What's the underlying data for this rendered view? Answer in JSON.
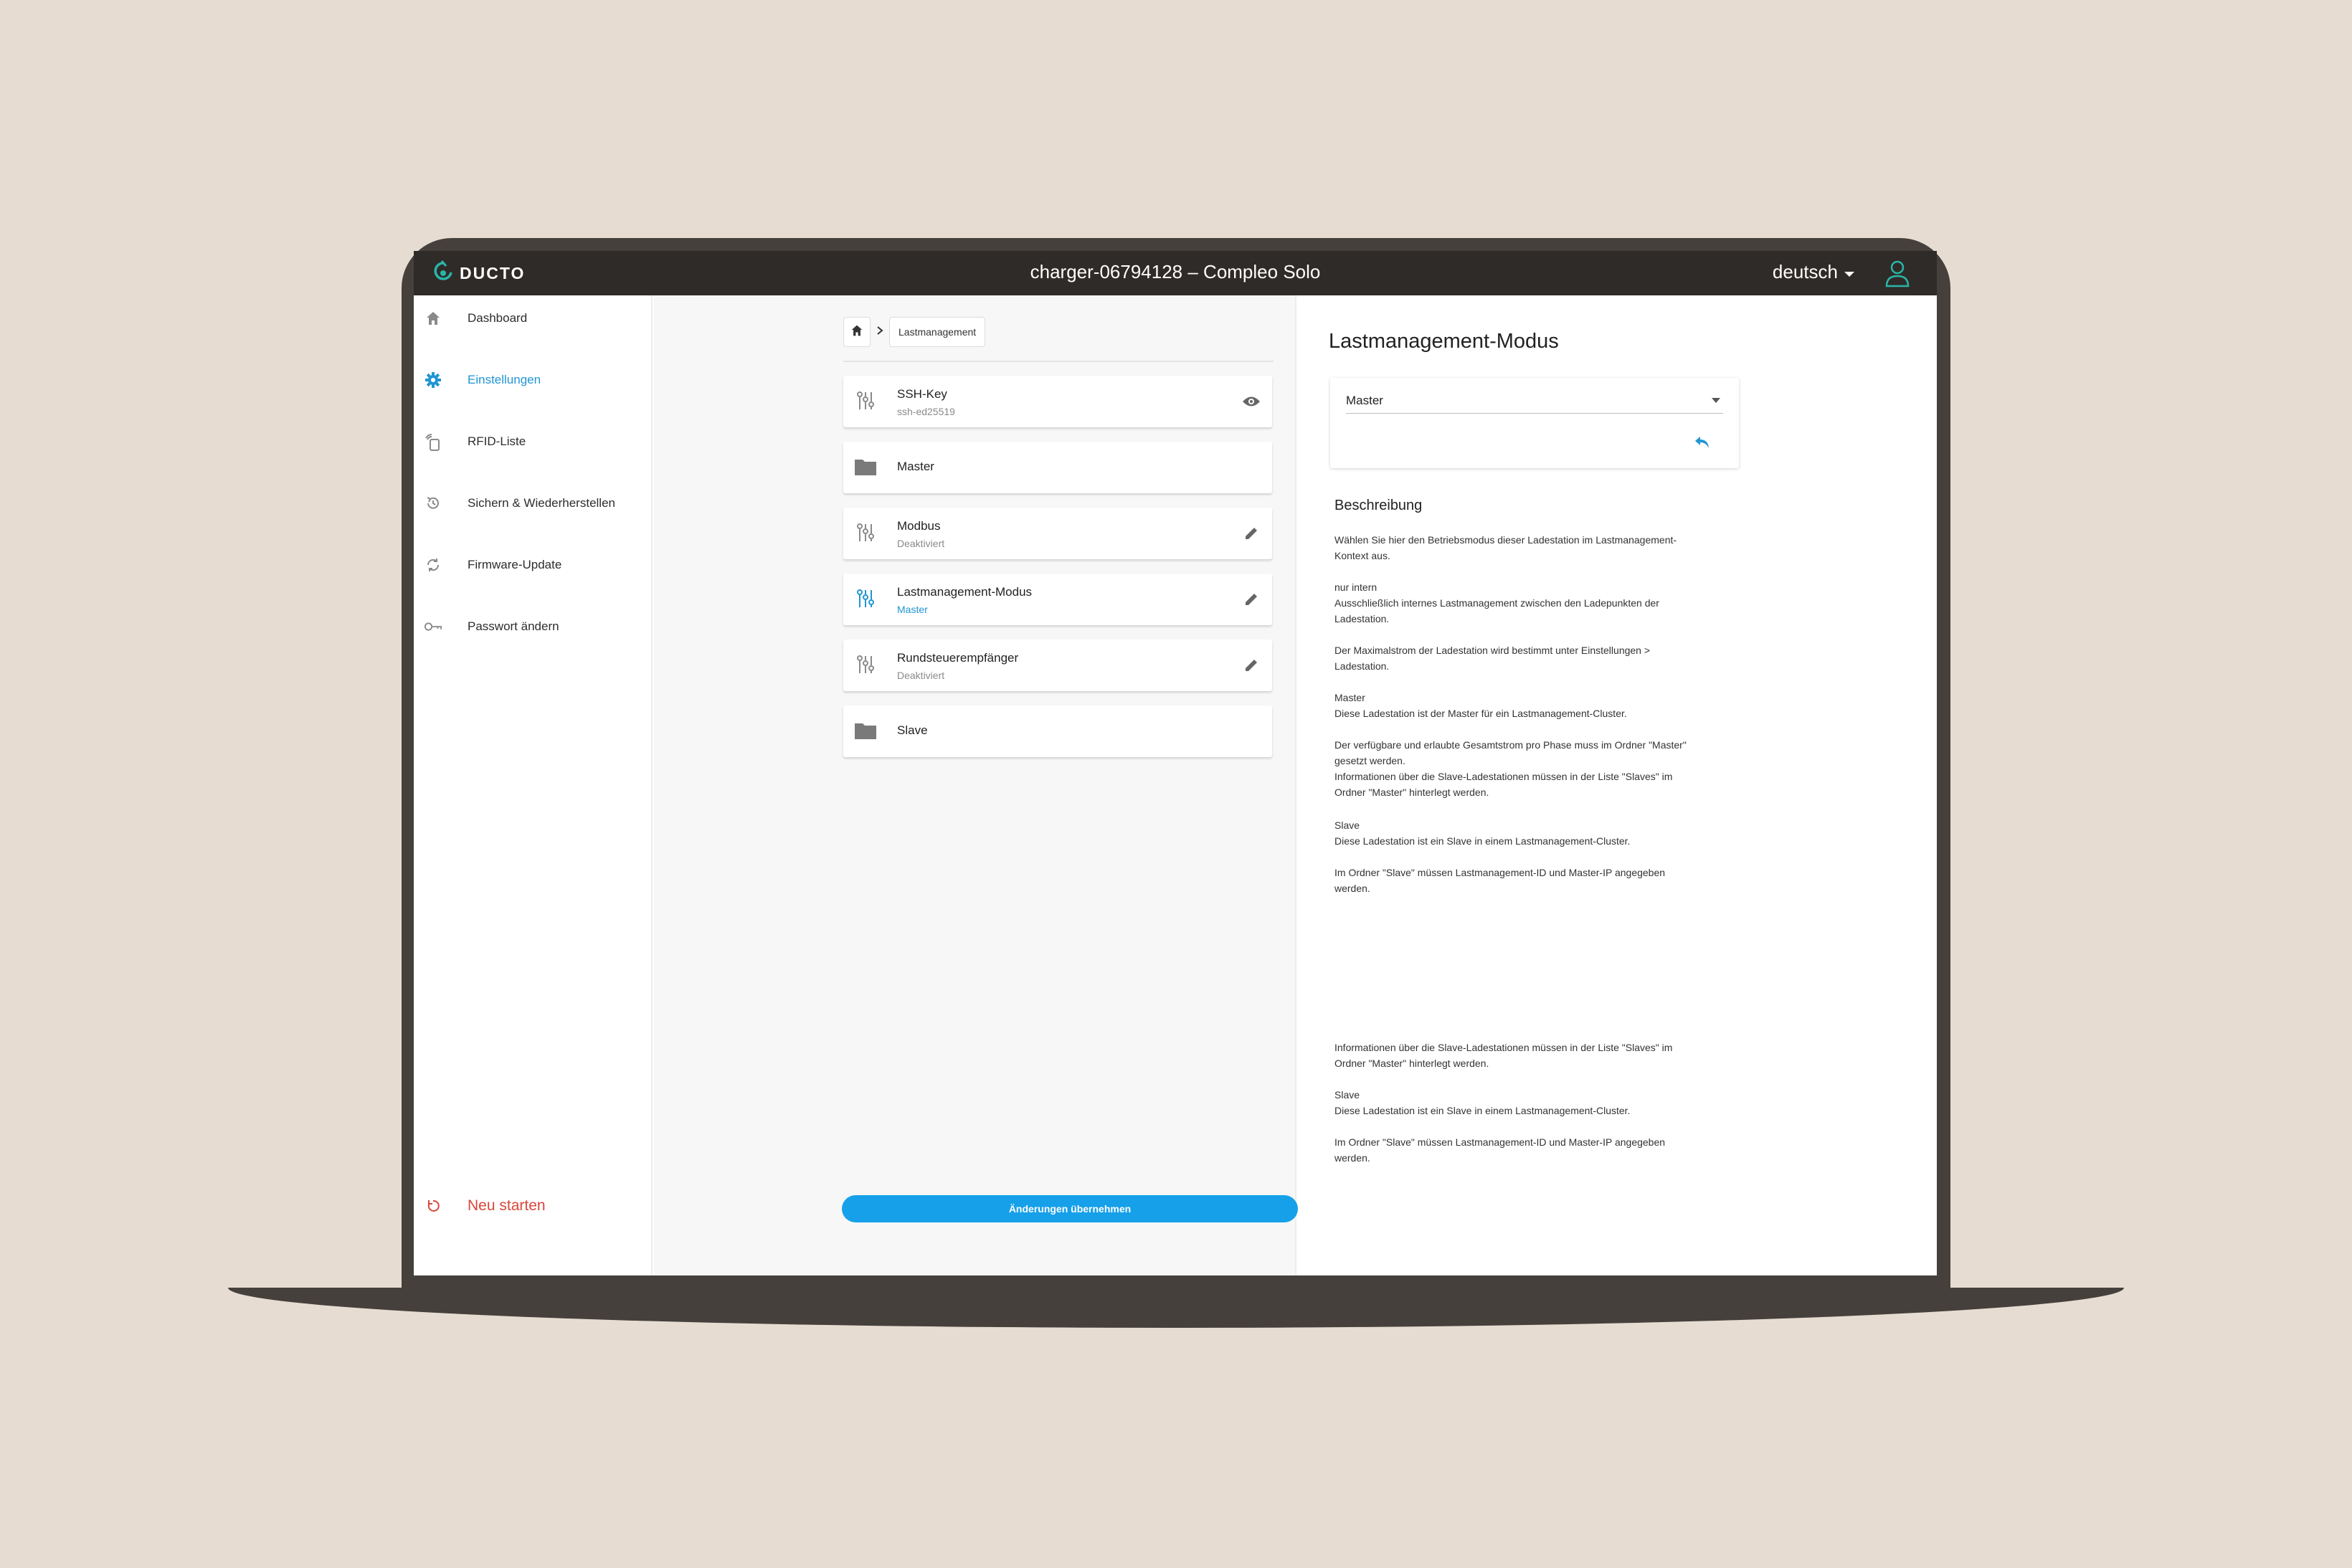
{
  "topbar": {
    "brand": "DUCTO",
    "device_title": "charger-06794128 – Compleo Solo",
    "language": "deutsch"
  },
  "sidebar": {
    "items": [
      {
        "label": "Dashboard",
        "icon": "home-icon",
        "active": false
      },
      {
        "label": "Einstellungen",
        "icon": "gear-icon",
        "active": true
      },
      {
        "label": "RFID-Liste",
        "icon": "rfid-card-icon",
        "active": false
      },
      {
        "label": "Sichern & Wiederherstellen",
        "icon": "history-icon",
        "active": false
      },
      {
        "label": "Firmware-Update",
        "icon": "sync-icon",
        "active": false
      },
      {
        "label": "Passwort ändern",
        "icon": "key-icon",
        "active": false
      }
    ],
    "restart_label": "Neu starten"
  },
  "breadcrumb": {
    "current": "Lastmanagement"
  },
  "settings_list": [
    {
      "title": "SSH-Key",
      "subtitle": "ssh-ed25519",
      "icon": "tune-icon",
      "action": "eye-icon"
    },
    {
      "title": "Master",
      "subtitle": "",
      "icon": "folder-icon",
      "action": ""
    },
    {
      "title": "Modbus",
      "subtitle": "Deaktiviert",
      "icon": "tune-icon",
      "action": "edit-icon"
    },
    {
      "title": "Lastmanagement-Modus",
      "subtitle": "Master",
      "icon": "tune-icon",
      "action": "edit-icon",
      "active": true
    },
    {
      "title": "Rundsteuerempfänger",
      "subtitle": "Deaktiviert",
      "icon": "tune-icon",
      "action": "edit-icon"
    },
    {
      "title": "Slave",
      "subtitle": "",
      "icon": "folder-icon",
      "action": ""
    }
  ],
  "apply_button": "Änderungen übernehmen",
  "detail": {
    "title": "Lastmanagement-Modus",
    "select_value": "Master",
    "description_heading": "Beschreibung",
    "paragraphs": [
      [
        "Wählen Sie hier den Betriebsmodus dieser Ladestation im Lastmanagement-",
        "Kontext aus."
      ],
      [
        "nur intern",
        "Ausschließlich internes Lastmanagement zwischen den Ladepunkten der",
        "Ladestation."
      ],
      [
        "Der Maximalstrom der Ladestation wird bestimmt unter Einstellungen >",
        "Ladestation."
      ],
      [
        "Master",
        "Diese Ladestation ist der Master für ein Lastmanagement-Cluster."
      ],
      [
        "Der verfügbare und erlaubte Gesamtstrom pro Phase muss im Ordner \"Master\"",
        "gesetzt werden.",
        "Informationen über die Slave-Ladestationen müssen in der Liste \"Slaves\" im",
        "Ordner \"Master\" hinterlegt werden."
      ],
      [
        "Slave",
        "Diese Ladestation ist ein Slave in einem Lastmanagement-Cluster."
      ],
      [
        "Im Ordner \"Slave\" müssen Lastmanagement-ID und Master-IP angegeben",
        "werden."
      ],
      [
        "Informationen über die Slave-Ladestationen müssen in der Liste \"Slaves\" im",
        "Ordner \"Master\" hinterlegt werden."
      ],
      [
        "Slave",
        "Diese Ladestation ist ein Slave in einem Lastmanagement-Cluster."
      ],
      [
        "Im Ordner \"Slave\" müssen Lastmanagement-ID und Master-IP angegeben",
        "werden."
      ]
    ]
  },
  "colors": {
    "accent": "#2196d3",
    "topbar": "#2f2b28",
    "restart": "#d9463b",
    "button": "#16a0ea",
    "frame": "#45403b",
    "background": "#e6dcd2"
  }
}
